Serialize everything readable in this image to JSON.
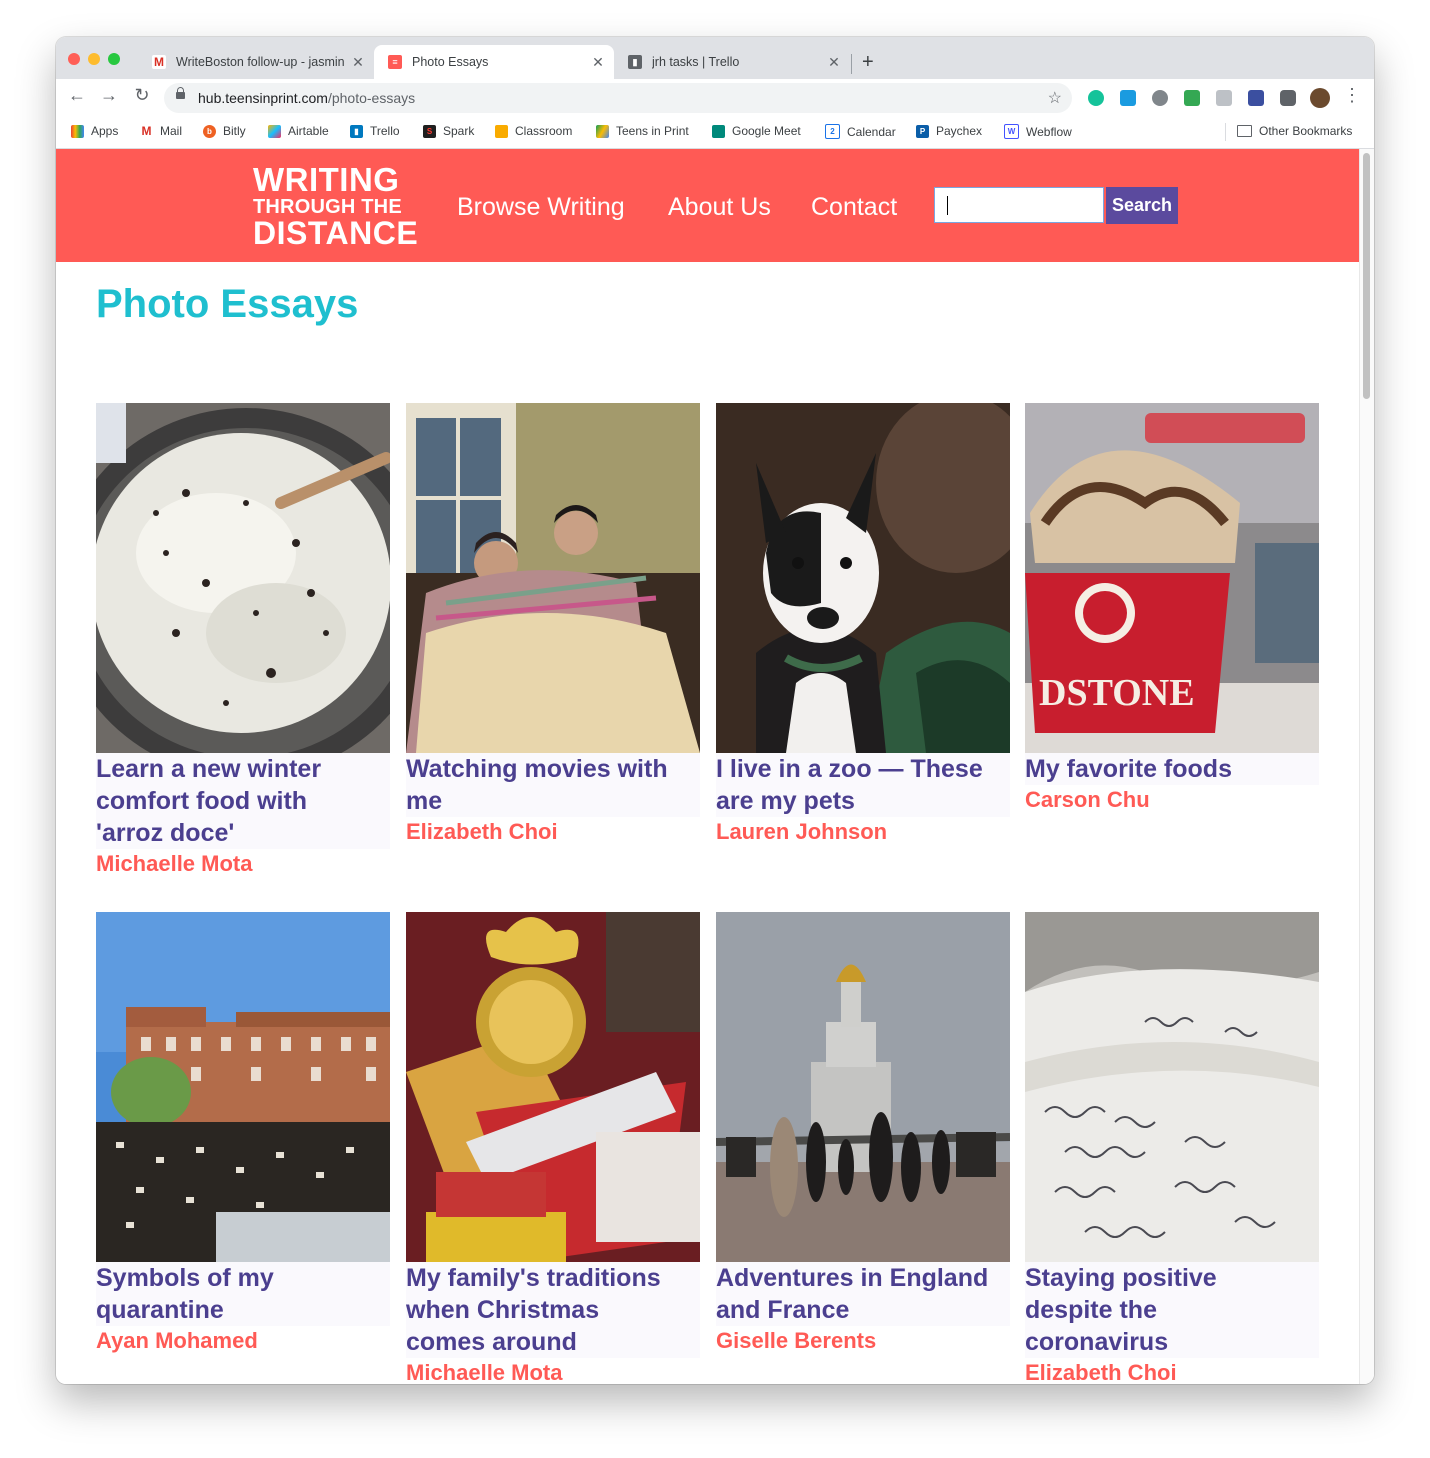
{
  "browser": {
    "tabs": [
      {
        "title": "WriteBoston follow-up - jasmin",
        "icon": "gmail-icon",
        "active": false
      },
      {
        "title": "Photo Essays",
        "icon": "teensinprint-icon",
        "active": true
      },
      {
        "title": "jrh tasks | Trello",
        "icon": "trello-icon",
        "active": false
      }
    ],
    "url_host": "hub.teensinprint.com",
    "url_path": "/photo-essays",
    "bookmarks": [
      {
        "label": "Apps",
        "icon": "apps-grid-icon"
      },
      {
        "label": "Mail",
        "icon": "gmail-icon"
      },
      {
        "label": "Bitly",
        "icon": "bitly-icon"
      },
      {
        "label": "Airtable",
        "icon": "airtable-icon"
      },
      {
        "label": "Trello",
        "icon": "trello-icon"
      },
      {
        "label": "Spark",
        "icon": "spark-icon"
      },
      {
        "label": "Classroom",
        "icon": "classroom-icon"
      },
      {
        "label": "Teens in Print",
        "icon": "drive-icon"
      },
      {
        "label": "Google Meet",
        "icon": "meet-icon"
      },
      {
        "label": "Calendar",
        "icon": "calendar-icon"
      },
      {
        "label": "Paychex",
        "icon": "paychex-icon"
      },
      {
        "label": "Webflow",
        "icon": "webflow-icon"
      }
    ],
    "other_bookmarks": "Other Bookmarks"
  },
  "site": {
    "logo_line1": "WRITING",
    "logo_line2": "THROUGH THE",
    "logo_line3": "DISTANCE",
    "nav": [
      "Browse Writing",
      "About Us",
      "Contact"
    ],
    "search_button": "Search",
    "colors": {
      "header": "#ff5a55",
      "title": "#1fbfcf",
      "card_title": "#4b3f8f",
      "author": "#ff5a55",
      "search_button": "#5b4a9e"
    }
  },
  "page_title": "Photo Essays",
  "cards": [
    {
      "title_lines": [
        "Learn a new winter",
        "comfort food with",
        "'arroz doce'"
      ],
      "author": "Michaelle Mota",
      "photo": "rice-pudding-photo"
    },
    {
      "title_lines": [
        "Watching movies with",
        "me"
      ],
      "author": "Elizabeth Choi",
      "photo": "couple-blanket-photo"
    },
    {
      "title_lines": [
        "I live in a zoo — These",
        "are my pets"
      ],
      "author": "Lauren Johnson",
      "photo": "dog-photo"
    },
    {
      "title_lines": [
        "My favorite foods"
      ],
      "author": "Carson Chu",
      "photo": "ice-cream-photo"
    },
    {
      "title_lines": [
        "Symbols of my",
        "quarantine"
      ],
      "author": "Ayan Mohamed",
      "photo": "protest-crowd-photo"
    },
    {
      "title_lines": [
        "My family's traditions",
        "when Christmas",
        "comes around"
      ],
      "author": "Michaelle Mota",
      "photo": "christmas-treats-photo"
    },
    {
      "title_lines": [
        "Adventures in England",
        "and France"
      ],
      "author": "Giselle Berents",
      "photo": "monument-photo"
    },
    {
      "title_lines": [
        "Staying positive",
        "despite the",
        "coronavirus"
      ],
      "author": "Elizabeth Choi",
      "photo": "handwritten-notebook-photo"
    }
  ]
}
